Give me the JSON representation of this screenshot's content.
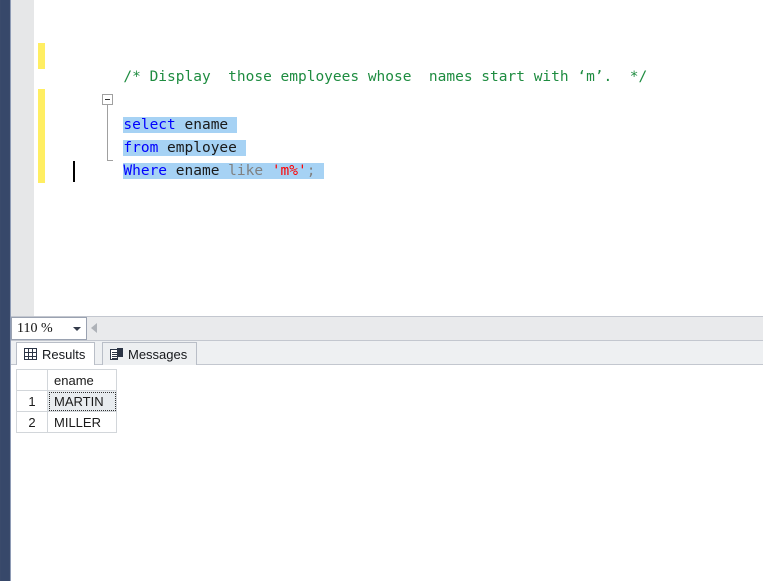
{
  "window": {
    "left_rail_color": "#37486a"
  },
  "editor": {
    "change_bar_color": "#ffee62",
    "selection_color": "#a6d2f4",
    "outline_collapse_icon": "collapse-minus-icon",
    "lines": [
      {
        "kind": "comment",
        "text": "/* Display  those employees whose  names start with ‘m’.  */"
      },
      {
        "kind": "code",
        "tokens": [
          {
            "t": "select",
            "c": "keyword"
          },
          {
            "t": " ",
            "c": "ident"
          },
          {
            "t": "ename",
            "c": "ident"
          }
        ]
      },
      {
        "kind": "code",
        "tokens": [
          {
            "t": "from",
            "c": "keyword"
          },
          {
            "t": " ",
            "c": "ident"
          },
          {
            "t": "employee",
            "c": "ident"
          }
        ]
      },
      {
        "kind": "code",
        "tokens": [
          {
            "t": "Where",
            "c": "keyword"
          },
          {
            "t": " ",
            "c": "ident"
          },
          {
            "t": "ename",
            "c": "ident"
          },
          {
            "t": " ",
            "c": "ident"
          },
          {
            "t": "like",
            "c": "op"
          },
          {
            "t": " ",
            "c": "ident"
          },
          {
            "t": "'m%'",
            "c": "string"
          },
          {
            "t": ";",
            "c": "punct"
          }
        ]
      }
    ],
    "line1_text": "/* Display  those employees whose  names start with ‘m’.  */",
    "line2_keyword": "select",
    "line2_ident": "ename",
    "line3_keyword": "from",
    "line3_ident": "employee",
    "line4_keyword": "Where",
    "line4_ident": "ename",
    "line4_op": "like",
    "line4_string": "'m%'",
    "line4_punct": ";"
  },
  "status_bar": {
    "zoom_value": "110 %",
    "zoom_dropdown_icon": "chevron-down-icon",
    "scroll_left_icon": "scroll-left-arrow-icon"
  },
  "results_pane": {
    "tabs": [
      {
        "id": "results",
        "label": "Results",
        "icon": "grid-icon",
        "active": true
      },
      {
        "id": "messages",
        "label": "Messages",
        "icon": "message-document-icon",
        "active": false
      }
    ],
    "grid": {
      "columns": [
        "ename"
      ],
      "rows": [
        {
          "num": "1",
          "values": [
            "MARTIN"
          ],
          "selected": true
        },
        {
          "num": "2",
          "values": [
            "MILLER"
          ],
          "selected": false
        }
      ]
    }
  }
}
